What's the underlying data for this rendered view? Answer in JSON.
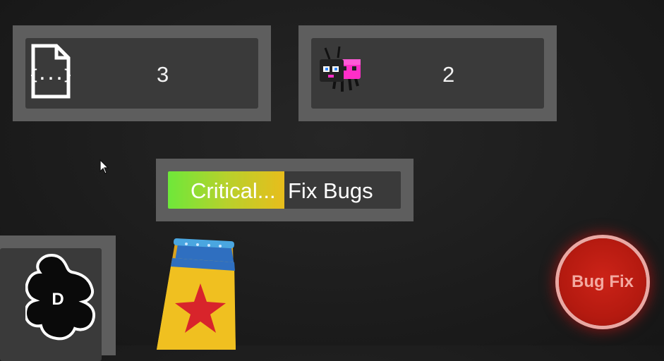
{
  "resources": {
    "code_files": {
      "count": "3",
      "icon": "code-file-icon"
    },
    "bugs": {
      "count": "2",
      "icon": "bug-icon"
    }
  },
  "task": {
    "status": "Critical...",
    "name": "Fix Bugs",
    "progress": 0.5
  },
  "plugin": {
    "letter": "D",
    "icon": "puzzle-piece-icon"
  },
  "bugfix_button": {
    "label": "Bug Fix"
  },
  "colors": {
    "panel": "#5e5e5e",
    "panel_inner": "#3a3a3a",
    "progress_start": "#6ee83a",
    "progress_end": "#e8bd1c",
    "bugfix_red": "#b51a10"
  }
}
